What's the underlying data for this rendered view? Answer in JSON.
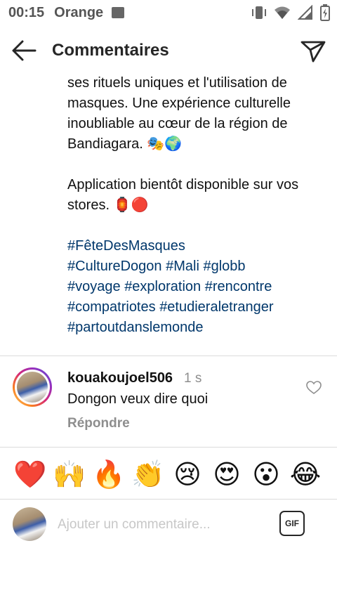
{
  "status_bar": {
    "time": "00:15",
    "carrier": "Orange",
    "icons": [
      "image-icon",
      "vibrate-icon",
      "wifi-icon",
      "signal-icon",
      "battery-icon"
    ]
  },
  "header": {
    "title": "Commentaires",
    "back_icon": "arrow-left-icon",
    "send_icon": "paper-plane-icon"
  },
  "caption": {
    "paragraph1": "ses rituels uniques et l'utilisation de masques. Une expérience culturelle inoubliable au cœur de la région de Bandiagara. 🎭🌍",
    "paragraph2": "Application bientôt disponible sur vos stores. 🏮🔴",
    "hashtags": [
      "#FêteDesMasques",
      "#CultureDogon",
      "#Mali",
      "#globb",
      "#voyage",
      "#exploration",
      "#rencontre",
      "#compatriotes",
      "#etudieraletranger",
      "#partoutdanslemonde"
    ]
  },
  "comments": [
    {
      "username": "kouakoujoel506",
      "time": "1 s",
      "text": "Dongon veux dire quoi",
      "reply_label": "Répondre"
    }
  ],
  "quick_emojis": [
    "❤️",
    "🙌",
    "🔥",
    "👏",
    "😢",
    "😍",
    "😮",
    "😂"
  ],
  "composer": {
    "placeholder": "Ajouter un commentaire...",
    "gif_label": "GIF"
  },
  "colors": {
    "hashtag": "#00376b",
    "secondary_text": "#8e8e8e",
    "divider": "#dbdbdb"
  }
}
